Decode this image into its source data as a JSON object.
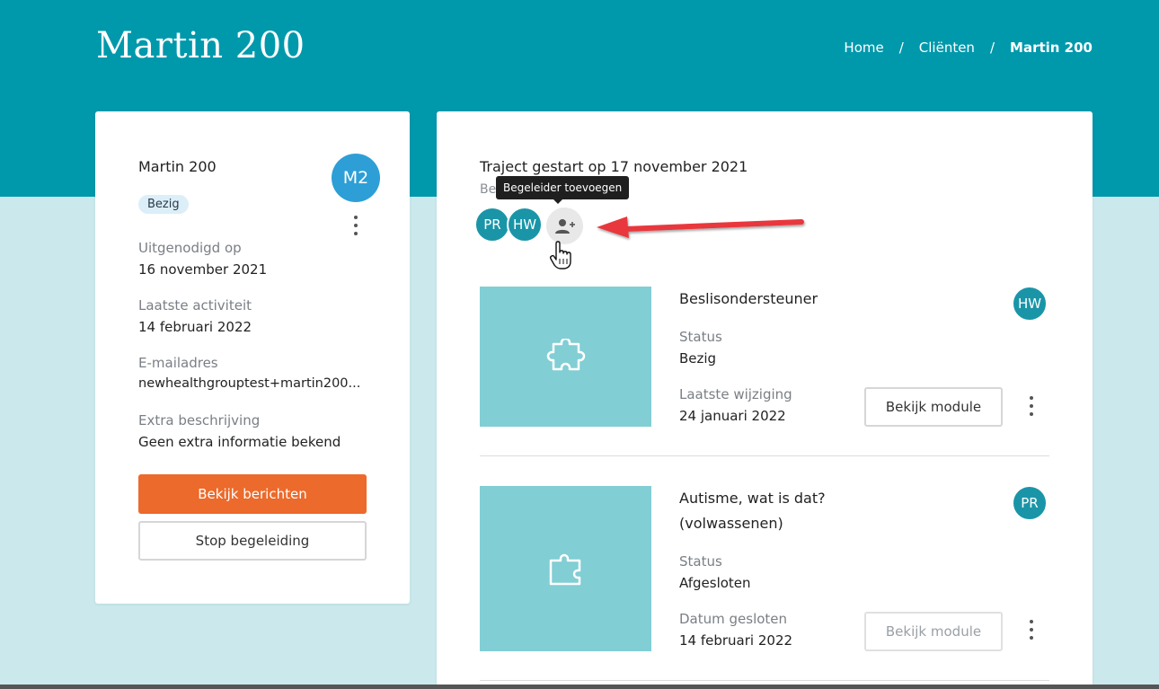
{
  "colors": {
    "header_bg": "#0099ac",
    "page_bg": "#cbe9ed",
    "accent_orange": "#ec6a2b",
    "avatar_teal": "#1a95a8",
    "avatar_blue": "#2d9fd6",
    "module_thumb": "#81ced4",
    "arrow_red": "#e8383d"
  },
  "header": {
    "title": "Martin 200",
    "breadcrumb": {
      "home": "Home",
      "separator": "/",
      "clients": "Cliënten",
      "current": "Martin 200"
    }
  },
  "client_card": {
    "name": "Martin 200",
    "avatar_initials": "M2",
    "status": "Bezig",
    "fields": [
      {
        "label": "Uitgenodigd op",
        "value": "16 november 2021"
      },
      {
        "label": "Laatste activiteit",
        "value": "14 februari 2022"
      },
      {
        "label": "E-mailadres",
        "value": "newhealthgrouptest+martin200..."
      },
      {
        "label": "Extra beschrijving",
        "value": "Geen extra informatie bekend"
      }
    ],
    "messages_button": "Bekijk berichten",
    "stop_button": "Stop begeleiding",
    "menu_icon": "kebab-vertical-icon"
  },
  "traject": {
    "title": "Traject gestart op 17 november 2021",
    "label_partial": "Be",
    "tooltip": "Begeleider toevoegen",
    "counselors": [
      "PR",
      "HW"
    ],
    "add_icon": "person-add-icon",
    "modules": [
      {
        "title_line1": "Beslisondersteuner",
        "title_line2": "",
        "icon": "puzzle-outline-icon",
        "assignee": "HW",
        "status_label": "Status",
        "status": "Bezig",
        "date_label": "Laatste wijziging",
        "date": "24 januari 2022",
        "button": "Bekijk module",
        "button_enabled": true
      },
      {
        "title_line1": "Autisme, wat is dat?",
        "title_line2": "(volwassenen)",
        "icon": "puzzle-piece-icon",
        "assignee": "PR",
        "status_label": "Status",
        "status": "Afgesloten",
        "date_label": "Datum gesloten",
        "date": "14 februari 2022",
        "button": "Bekijk module",
        "button_enabled": false
      }
    ]
  }
}
